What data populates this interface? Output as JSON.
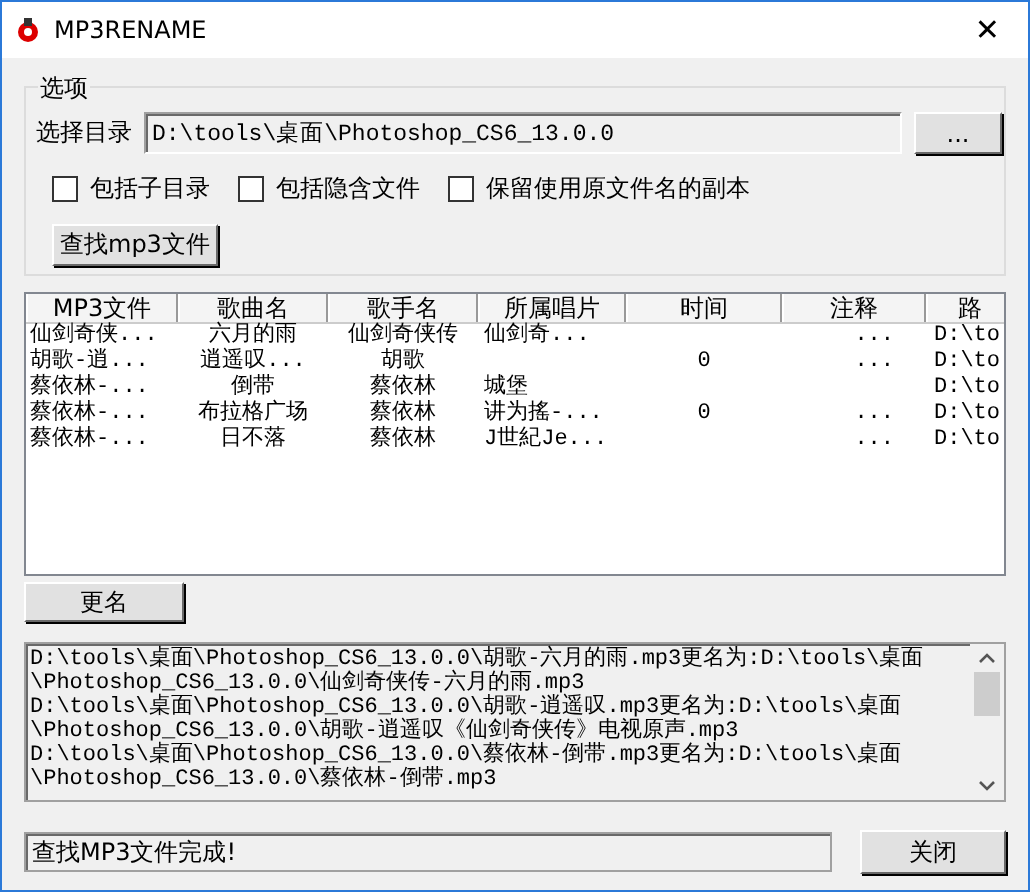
{
  "window": {
    "title": "MP3RENAME",
    "close": "✕"
  },
  "options": {
    "label": "选项",
    "dir_label": "选择目录",
    "dir_value": "D:\\tools\\桌面\\Photoshop_CS6_13.0.0",
    "browse": "...",
    "checkboxes": [
      {
        "label": "包括子目录",
        "checked": false
      },
      {
        "label": "包括隐含文件",
        "checked": false
      },
      {
        "label": "保留使用原文件名的副本",
        "checked": false
      }
    ],
    "find_button": "查找mp3文件"
  },
  "table": {
    "columns": [
      "MP3文件",
      "歌曲名",
      "歌手名",
      "所属唱片",
      "时间",
      "注释",
      "路"
    ],
    "rows": [
      [
        "仙剑奇侠...",
        "六月的雨",
        "仙剑奇侠传",
        "仙剑奇...",
        "",
        "...",
        "D:\\to"
      ],
      [
        "胡歌-逍...",
        "逍遥叹...",
        "胡歌",
        "",
        "0",
        "...",
        "D:\\to"
      ],
      [
        "蔡依林-...",
        "倒带",
        "蔡依林",
        "城堡",
        "",
        "",
        "D:\\to"
      ],
      [
        "蔡依林-...",
        "布拉格广场",
        "蔡依林",
        "讲为搖-...",
        "0",
        "...",
        "D:\\to"
      ],
      [
        "蔡依林-...",
        "日不落",
        "蔡依林",
        "J世紀Je...",
        "",
        "...",
        "D:\\to"
      ]
    ]
  },
  "rename_button": "更名",
  "log": [
    "D:\\tools\\桌面\\Photoshop_CS6_13.0.0\\胡歌-六月的雨.mp3更名为:D:\\tools\\桌面",
    "\\Photoshop_CS6_13.0.0\\仙剑奇侠传-六月的雨.mp3",
    "D:\\tools\\桌面\\Photoshop_CS6_13.0.0\\胡歌-逍遥叹.mp3更名为:D:\\tools\\桌面",
    "\\Photoshop_CS6_13.0.0\\胡歌-逍遥叹《仙剑奇侠传》电视原声.mp3",
    "D:\\tools\\桌面\\Photoshop_CS6_13.0.0\\蔡依林-倒带.mp3更名为:D:\\tools\\桌面",
    "\\Photoshop_CS6_13.0.0\\蔡依林-倒带.mp3"
  ],
  "status": "查找MP3文件完成!",
  "close_button": "关闭"
}
